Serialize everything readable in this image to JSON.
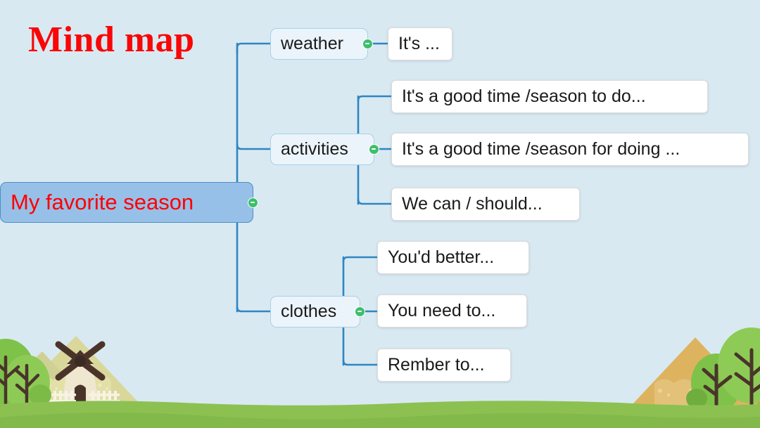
{
  "page": {
    "title": "Mind map",
    "background_color": "#d9e9f2"
  },
  "colors": {
    "title_red": "#f90606",
    "root_text_red": "#ff0000",
    "root_fill": "#97c0e8",
    "root_border": "#4a90c4",
    "branch_fill": "#ebf4fb",
    "branch_border": "#a8d0e8",
    "leaf_fill": "#ffffff",
    "leaf_border": "#dcdcdc",
    "connector_line": "#2e86c1",
    "collapse_dot": "#3dbf6b",
    "grass_green": "#8cc152",
    "hill_tan_left": "#d9d79a",
    "hill_tan_right": "#ddb35f",
    "tree_green": "#7ec24a",
    "trunk_brown": "#4a342a"
  },
  "mindmap": {
    "root": {
      "label": "My favorite season",
      "collapse_icon": "collapse-dot-icon"
    },
    "branches": [
      {
        "label": "weather",
        "collapse_icon": "collapse-dot-icon",
        "leaves": [
          {
            "label": "It's ..."
          }
        ]
      },
      {
        "label": "activities",
        "collapse_icon": "collapse-dot-icon",
        "leaves": [
          {
            "label": "It's a good time /season to do..."
          },
          {
            "label": "It's a good time /season for doing ..."
          },
          {
            "label": "We can / should..."
          }
        ]
      },
      {
        "label": "clothes",
        "collapse_icon": "collapse-dot-icon",
        "leaves": [
          {
            "label": "You'd better..."
          },
          {
            "label": "You need to..."
          },
          {
            "label": "Rember to..."
          }
        ]
      }
    ]
  },
  "decoration": {
    "scene_name": "countryside-landscape",
    "elements": [
      "windmill-icon",
      "fence-icon",
      "tree-icon",
      "hill-icon",
      "grass-icon"
    ]
  }
}
